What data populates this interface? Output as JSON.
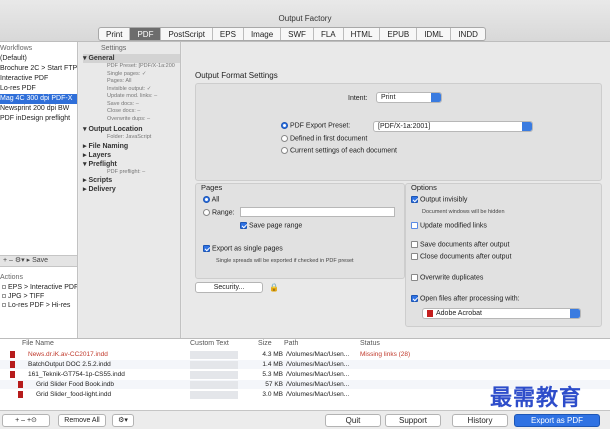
{
  "window": {
    "title": "Output Factory"
  },
  "tabs": [
    "Print",
    "PDF",
    "PostScript",
    "EPS",
    "Image",
    "SWF",
    "FLA",
    "HTML",
    "EPUB",
    "IDML",
    "INDD"
  ],
  "active_tab": "PDF",
  "workflows": {
    "header": "Workflows",
    "items": [
      "(Default)",
      "Brochure 2C > Start FTP",
      "Interactive PDF",
      "Lo-res PDF",
      "Mag 4C 300 dpi PDF-X",
      "Newsprint 200 dpi BW",
      "PDF inDesign preflight"
    ],
    "selected_index": 4,
    "toolbar": "+  –  ⚙▾  ▸ Save"
  },
  "actions": {
    "header": "Actions",
    "items": [
      "EPS > Interactive PDF",
      "JPG > TIFF",
      "Lo-res PDF > Hi-res"
    ]
  },
  "settings_tree": {
    "header": "Settings",
    "general": "General",
    "general_details": [
      "PDF Preset: [PDF/X-1a:200",
      "Single pages: ✓",
      "Pages: All",
      "Invisible output: ✓",
      "Update mod. links: –",
      "Save docs: –",
      "Close docs: –",
      "Overwrite dups: –"
    ],
    "output_location": "Output Location",
    "output_location_details": [
      "Folder: JavaScript"
    ],
    "file_naming": "File Naming",
    "layers": "Layers",
    "preflight": "Preflight",
    "preflight_details": [
      "PDF preflight: –"
    ],
    "scripts": "Scripts",
    "delivery": "Delivery"
  },
  "output_format": {
    "heading": "Output Format Settings",
    "intent_label": "Intent:",
    "intent_value": "Print",
    "preset_option": "PDF Export Preset:",
    "preset_value": "[PDF/X-1a:2001]",
    "option_defined": "Defined in first document",
    "option_current": "Current settings of each document"
  },
  "pages": {
    "heading": "Pages",
    "all": "All",
    "range": "Range:",
    "save_range": "Save page range",
    "export_single": "Export as single pages",
    "single_note": "Single spreads will be exported if checked in PDF preset",
    "security": "Security..."
  },
  "options": {
    "heading": "Options",
    "invisible": "Output invisibly",
    "invisible_note": "Document windows will be hidden",
    "update_links": "Update modified links",
    "save_docs": "Save documents after output",
    "close_docs": "Close documents after output",
    "overwrite": "Overwrite duplicates",
    "open_files": "Open files after processing with:",
    "open_with": "Adobe Acrobat"
  },
  "file_table": {
    "columns": [
      "File Name",
      "Custom Text",
      "Size",
      "Path",
      "Status"
    ],
    "rows": [
      {
        "name": "News.dr.iK.av-CC2017.indd",
        "size": "4.3 MB",
        "path": "/Volumes/Mac/Usen...",
        "status": "Missing links (28)",
        "error": true
      },
      {
        "name": "BatchOutput DOC 2.5.2.indd",
        "size": "1.4 MB",
        "path": "/Volumes/Mac/Usen...",
        "status": "",
        "error": false
      },
      {
        "name": "161_Teknik-GT754-1p-CS55.indd",
        "size": "5.3 MB",
        "path": "/Volumes/Mac/Usen...",
        "status": "",
        "error": false
      },
      {
        "name": "Grid Slider Food Book.indb",
        "size": "57 KB",
        "path": "/Volumes/Mac/Usen...",
        "status": "",
        "error": false
      },
      {
        "name": "Grid Slider_food-light.indd",
        "size": "3.0 MB",
        "path": "/Volumes/Mac/Usen...",
        "status": "",
        "error": false
      }
    ]
  },
  "bottom": {
    "file_tools": "+  –  +⊙",
    "remove_all": "Remove All",
    "gear": "⚙▾",
    "quit": "Quit",
    "support": "Support",
    "history": "History",
    "export": "Export as PDF"
  },
  "watermark": "最需教育",
  "colors": {
    "accent": "#2f72e3",
    "error": "#c0392b",
    "selection": "#2f6fd9"
  }
}
